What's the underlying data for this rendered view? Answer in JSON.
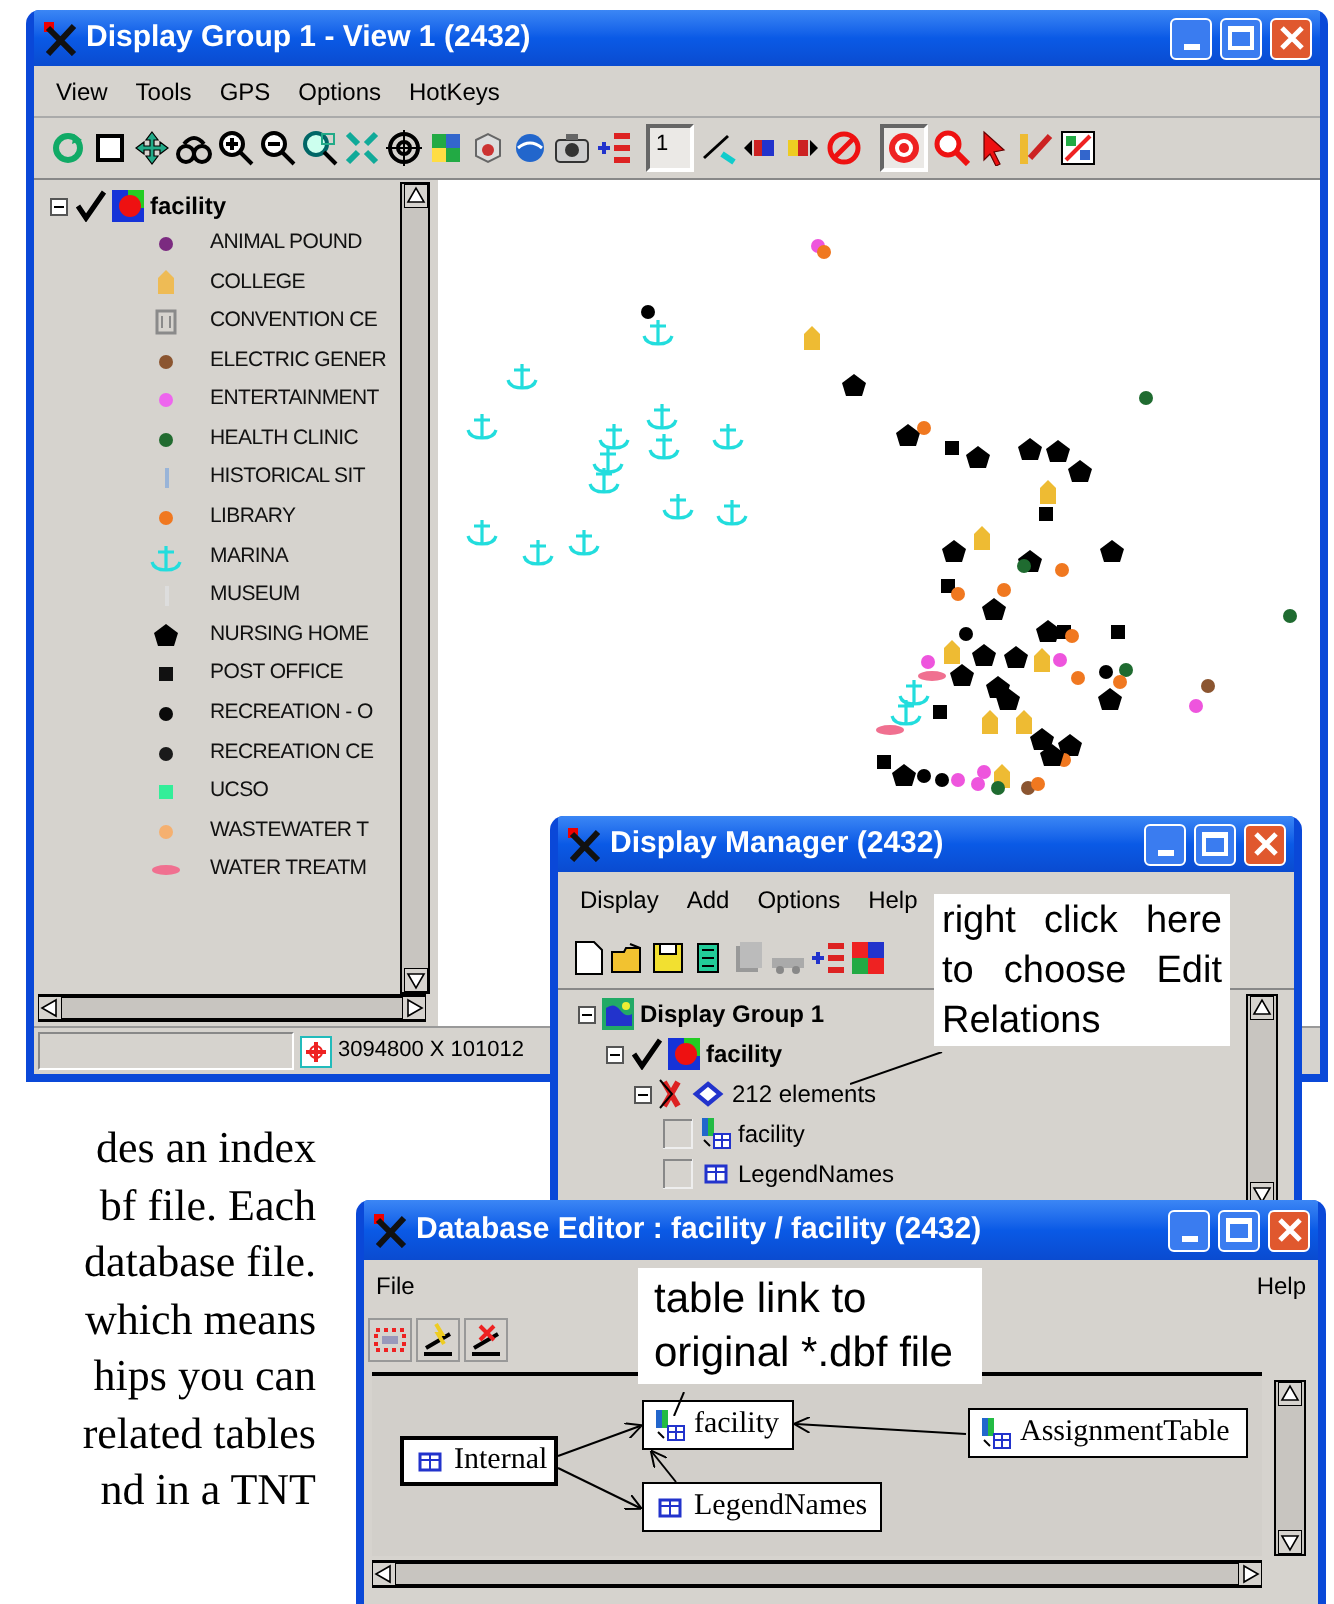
{
  "view_window": {
    "title": "Display Group 1 - View 1 (2432)",
    "menu": [
      "View",
      "Tools",
      "GPS",
      "Options",
      "HotKeys"
    ],
    "toolbar": {
      "page_button": {
        "label": "1",
        "selected": true
      },
      "target_button": {
        "selected": true
      }
    },
    "legend": {
      "layer": {
        "name": "facility",
        "expanded": true,
        "checked": true
      },
      "items": [
        {
          "label": "ANIMAL POUND",
          "kind": "dot",
          "color": "#7b2a80"
        },
        {
          "label": "COLLEGE",
          "kind": "house",
          "color": "#eebb55"
        },
        {
          "label": "CONVENTION CE",
          "kind": "box",
          "color": "#8a8a8a"
        },
        {
          "label": "ELECTRIC GENER",
          "kind": "dot",
          "color": "#8b5530"
        },
        {
          "label": "ENTERTAINMENT",
          "kind": "dot",
          "color": "#ee66ee"
        },
        {
          "label": "HEALTH CLINIC",
          "kind": "dot",
          "color": "#226b30"
        },
        {
          "label": "HISTORICAL SIT",
          "kind": "bar",
          "color": "#99b4d8"
        },
        {
          "label": "LIBRARY",
          "kind": "dot",
          "color": "#f07820"
        },
        {
          "label": "MARINA",
          "kind": "anchor",
          "color": "#22dddd"
        },
        {
          "label": "MUSEUM",
          "kind": "bar",
          "color": "#dddddd"
        },
        {
          "label": "NURSING HOME",
          "kind": "pentagon",
          "color": "#000000"
        },
        {
          "label": "POST OFFICE",
          "kind": "square",
          "color": "#111111"
        },
        {
          "label": "RECREATION - O",
          "kind": "dot",
          "color": "#0a0a0a"
        },
        {
          "label": "RECREATION CE",
          "kind": "dot",
          "color": "#1a1a1a"
        },
        {
          "label": "UCSO",
          "kind": "square",
          "color": "#33ee99"
        },
        {
          "label": "WASTEWATER T",
          "kind": "dot",
          "color": "#f5b070"
        },
        {
          "label": "WATER TREATM",
          "kind": "dash",
          "color": "#f07090"
        }
      ]
    },
    "status_bar": {
      "coordinates": "3094800 X 101012"
    }
  },
  "display_manager": {
    "title": "Display Manager (2432)",
    "menu": [
      "Display",
      "Add",
      "Options",
      "Help"
    ],
    "callout": "right click here to choose Edit Relations",
    "tree": [
      {
        "label": "Display Group 1",
        "kind": "group",
        "expanded": true,
        "children": [
          {
            "label": "facility",
            "kind": "layer",
            "expanded": true,
            "checked": true,
            "children": [
              {
                "label": "212 elements",
                "kind": "elements",
                "expanded": true,
                "children": [
                  {
                    "label": "facility",
                    "kind": "linked-table",
                    "checked": false
                  },
                  {
                    "label": "LegendNames",
                    "kind": "table",
                    "checked": false
                  }
                ]
              }
            ]
          }
        ]
      }
    ]
  },
  "database_editor": {
    "title": "Database Editor : facility / facility (2432)",
    "menu": [
      "File",
      "Help"
    ],
    "callout": "table link to original *.dbf file",
    "tables": [
      {
        "label": "Internal",
        "kind": "internal"
      },
      {
        "label": "facility",
        "kind": "linked"
      },
      {
        "label": "LegendNames",
        "kind": "internal"
      },
      {
        "label": "AssignmentTable",
        "kind": "linked"
      }
    ]
  },
  "document_text": [
    "des an index",
    "bf file. Each",
    "database file.",
    "which means",
    "hips you can",
    "related tables",
    "nd in a TNT"
  ]
}
